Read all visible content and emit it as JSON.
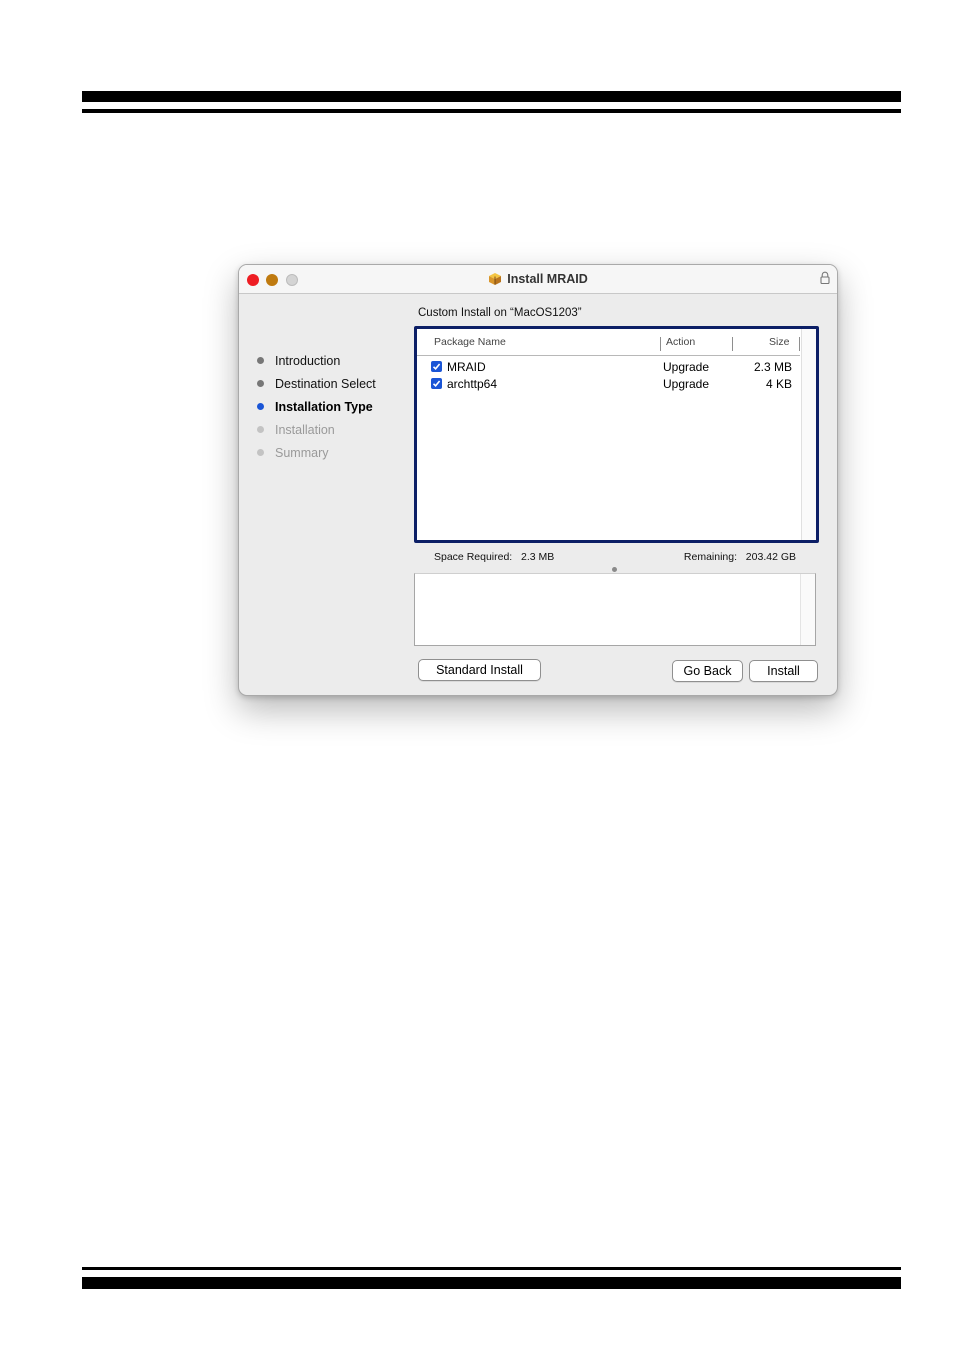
{
  "window": {
    "title": "Install MRAID",
    "icons": {
      "app": "package-icon",
      "lock": "lock-icon"
    }
  },
  "steps": [
    {
      "label": "Introduction",
      "state": "done"
    },
    {
      "label": "Destination Select",
      "state": "done"
    },
    {
      "label": "Installation Type",
      "state": "current"
    },
    {
      "label": "Installation",
      "state": "todo"
    },
    {
      "label": "Summary",
      "state": "todo"
    }
  ],
  "main": {
    "title": "Custom Install on “MacOS1203”",
    "table": {
      "headers": {
        "name": "Package Name",
        "action": "Action",
        "size": "Size"
      },
      "rows": [
        {
          "checked": true,
          "name": "MRAID",
          "action": "Upgrade",
          "size": "2.3 MB"
        },
        {
          "checked": true,
          "name": "archttp64",
          "action": "Upgrade",
          "size": "4 KB"
        }
      ]
    },
    "space_required_label": "Space Required:",
    "space_required_value": "2.3 MB",
    "remaining_label": "Remaining:",
    "remaining_value": "203.42 GB"
  },
  "buttons": {
    "standard_install": "Standard Install",
    "go_back": "Go Back",
    "install": "Install"
  },
  "colors": {
    "accent": "#1a55d6",
    "close": "#ee1d23",
    "minimize": "#bf7a0f",
    "focus_border": "#0c1f66"
  }
}
